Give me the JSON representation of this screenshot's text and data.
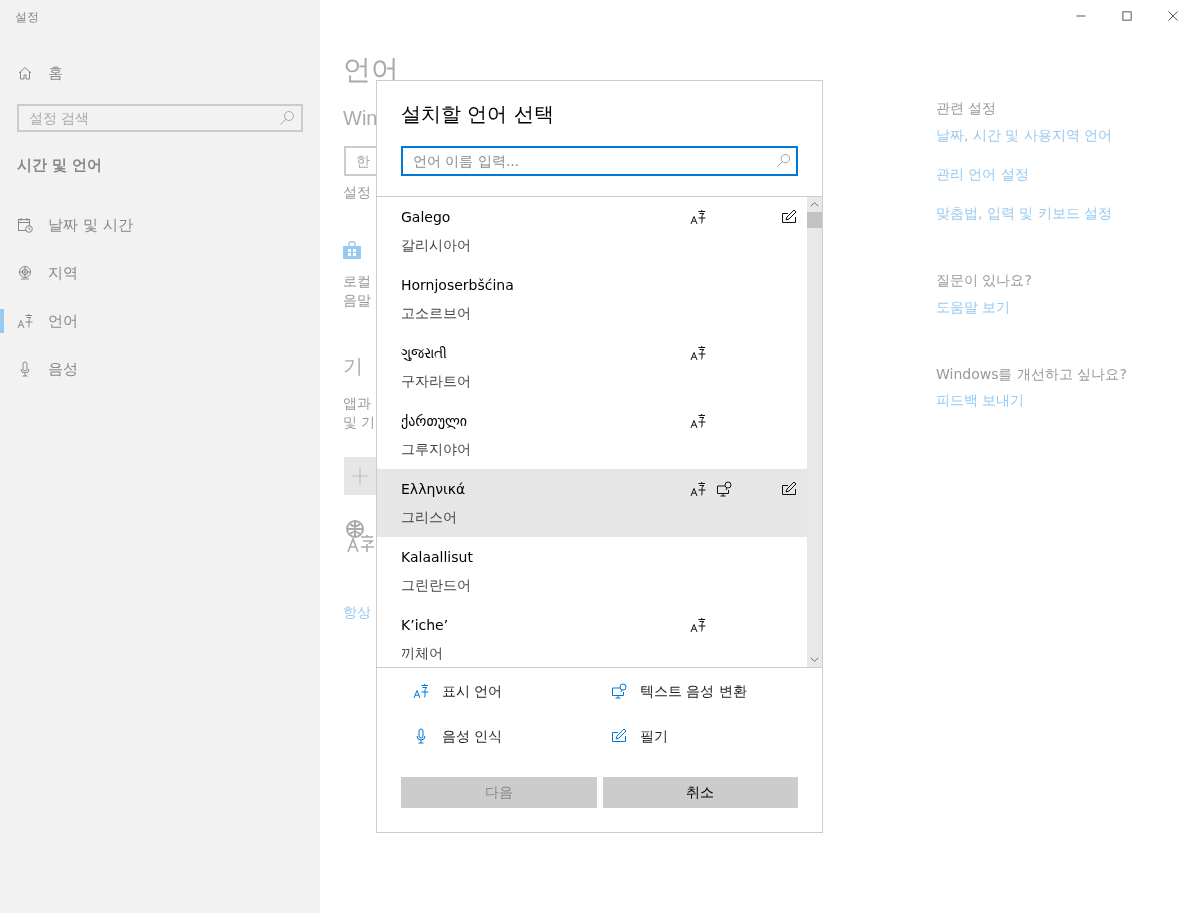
{
  "window": {
    "title": "설정"
  },
  "sidebar": {
    "home": "홈",
    "search": {
      "placeholder": "설정 검색"
    },
    "section": "시간 및 언어",
    "items": [
      {
        "label": "날짜 및 시간",
        "kind": "datetime",
        "selected": false
      },
      {
        "label": "지역",
        "kind": "region",
        "selected": false
      },
      {
        "label": "언어",
        "kind": "language",
        "selected": true
      },
      {
        "label": "음성",
        "kind": "speech",
        "selected": false
      }
    ]
  },
  "main": {
    "title": "언어",
    "subtitle": "Win",
    "field_value": "한",
    "note": "설정",
    "paragraph_lines": [
      "로컬",
      "음말"
    ],
    "heading": "기",
    "desc_lines": [
      "앱과",
      "및 기"
    ],
    "link": "항상"
  },
  "related": {
    "heading": "관련 설정",
    "links": [
      "날짜, 시간 및 사용지역 언어",
      "관리 언어 설정",
      "맞춤법, 입력 및 키보드 설정"
    ],
    "help": {
      "question": "질문이 있나요?",
      "link": "도움말 보기"
    },
    "feedback": {
      "question": "Windows를 개선하고 싶나요?",
      "link": "피드백 보내기"
    }
  },
  "dialog": {
    "title": "설치할 언어 선택",
    "search": {
      "placeholder": "언어 이름 입력..."
    },
    "languages": [
      {
        "name": "Galego",
        "korean": "갈리시아어",
        "display": true,
        "tts": false,
        "speech": false,
        "handwriting": true,
        "selected": false
      },
      {
        "name": "Hornjoserbšćina",
        "korean": "고소르브어",
        "display": false,
        "tts": false,
        "speech": false,
        "handwriting": false,
        "selected": false
      },
      {
        "name": "ગુજરાતી",
        "korean": "구자라트어",
        "display": true,
        "tts": false,
        "speech": false,
        "handwriting": false,
        "selected": false
      },
      {
        "name": "ქართული",
        "korean": "그루지야어",
        "display": true,
        "tts": false,
        "speech": false,
        "handwriting": false,
        "selected": false
      },
      {
        "name": "Ελληνικά",
        "korean": "그리스어",
        "display": true,
        "tts": true,
        "speech": false,
        "handwriting": true,
        "selected": true
      },
      {
        "name": "Kalaallisut",
        "korean": "그린란드어",
        "display": false,
        "tts": false,
        "speech": false,
        "handwriting": false,
        "selected": false
      },
      {
        "name": "K’iche’",
        "korean": "끼체어",
        "display": true,
        "tts": false,
        "speech": false,
        "handwriting": false,
        "selected": false
      }
    ],
    "legend": [
      {
        "kind": "display",
        "label": "표시 언어"
      },
      {
        "kind": "tts",
        "label": "텍스트 음성 변환"
      },
      {
        "kind": "speech",
        "label": "음성 인식"
      },
      {
        "kind": "handwriting",
        "label": "필기"
      }
    ],
    "buttons": [
      {
        "label": "다음",
        "disabled": true
      },
      {
        "label": "취소",
        "disabled": false
      }
    ]
  }
}
